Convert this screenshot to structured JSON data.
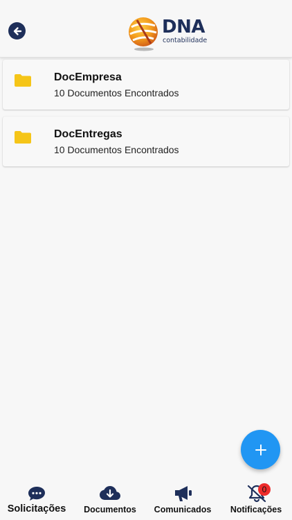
{
  "header": {
    "back_icon": "arrow-left-circle-icon",
    "logo_icon": "dna-globe-logo-icon",
    "logo_word": "DNA",
    "logo_sub": "contabilidade"
  },
  "folders": [
    {
      "name": "DocEmpresa",
      "count": "10 Documentos Encontrados",
      "icon": "folder-icon"
    },
    {
      "name": "DocEntregas",
      "count": "10 Documentos Encontrados",
      "icon": "folder-icon"
    }
  ],
  "fab": {
    "icon": "plus-icon"
  },
  "tabbar": {
    "items": [
      {
        "label": "Solicitações",
        "icon": "chat-bubble-icon",
        "active": true
      },
      {
        "label": "Documentos",
        "icon": "cloud-download-icon",
        "active": false
      },
      {
        "label": "Comunicados",
        "icon": "megaphone-icon",
        "active": false
      },
      {
        "label": "Notificações",
        "icon": "bell-off-icon",
        "active": false
      }
    ],
    "notification_badge": "0"
  },
  "colors": {
    "navy": "#1e2f5a",
    "folder": "#f5c518",
    "fab": "#2196f3",
    "badge": "#ee2b2b",
    "logo_orange": "#f39a1c"
  }
}
